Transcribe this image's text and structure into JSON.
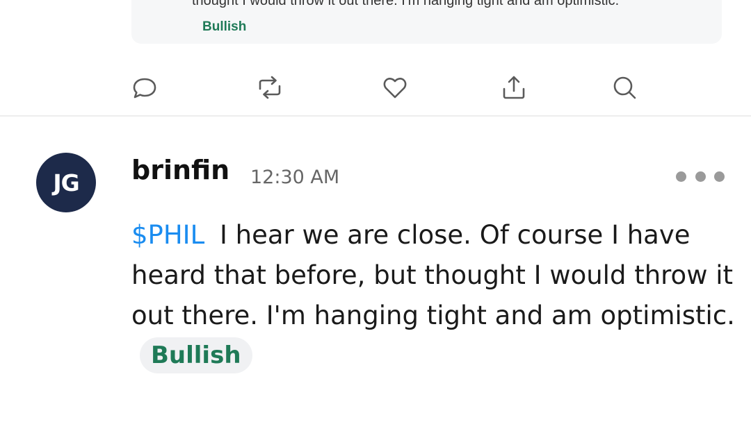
{
  "quoted_post": {
    "text_partial": "thought I would throw it out there. I'm hanging tight and am optimistic.",
    "sentiment": "Bullish"
  },
  "actions": {
    "reply": "comment-icon",
    "reshare": "repost-icon",
    "like": "heart-icon",
    "share": "share-icon",
    "search": "search-icon"
  },
  "post": {
    "avatar_initials": "JG",
    "username": "brinfin",
    "timestamp": "12:30 AM",
    "cashtag": "$PHIL",
    "body": "I hear we are close. Of course I have heard that before, but thought I would throw it out there. I'm hanging tight and am optimistic.",
    "sentiment": "Bullish"
  },
  "colors": {
    "avatar_bg": "#1d2a4a",
    "cashtag": "#1a8cf0",
    "bullish": "#1f7a57"
  }
}
